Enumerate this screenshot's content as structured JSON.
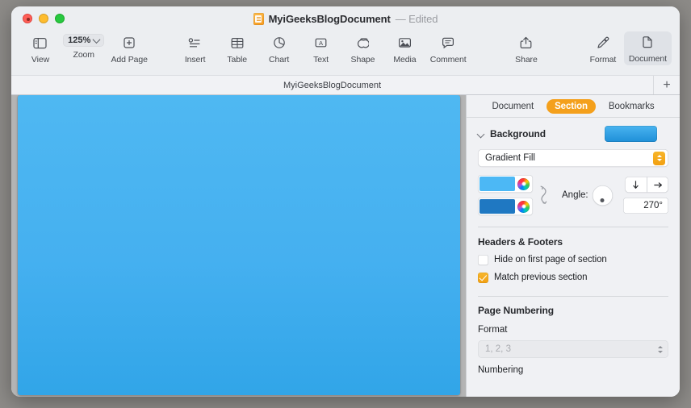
{
  "window": {
    "title": "MyiGeeksBlogDocument",
    "status": "— Edited",
    "doc_icon": "pages-document-icon"
  },
  "traffic_lights": {
    "close": "close-button",
    "minimize": "minimize-button",
    "zoom": "maximize-button"
  },
  "toolbar": {
    "view_label": "View",
    "zoom_value": "125%",
    "zoom_label": "Zoom",
    "add_page_label": "Add Page",
    "insert_label": "Insert",
    "table_label": "Table",
    "chart_label": "Chart",
    "text_label": "Text",
    "shape_label": "Shape",
    "media_label": "Media",
    "comment_label": "Comment",
    "share_label": "Share",
    "format_label": "Format",
    "document_label": "Document"
  },
  "tabbar": {
    "tab_title": "MyiGeeksBlogDocument",
    "add_tab": "+"
  },
  "inspector": {
    "segments": [
      {
        "label": "Document",
        "active": false
      },
      {
        "label": "Section",
        "active": true
      },
      {
        "label": "Bookmarks",
        "active": false
      }
    ],
    "background": {
      "title": "Background",
      "fill_type": "Gradient Fill",
      "swatch_color": "#3aa7e8",
      "start_color": "#4cb8f5",
      "end_color": "#1f78c2",
      "angle_label": "Angle:",
      "angle_value": "270°"
    },
    "headers_footers": {
      "title": "Headers & Footers",
      "hide_first_page": {
        "label": "Hide on first page of section",
        "checked": false
      },
      "match_previous": {
        "label": "Match previous section",
        "checked": true
      }
    },
    "page_numbering": {
      "title": "Page Numbering",
      "format_label": "Format",
      "format_value": "1, 2, 3",
      "numbering_label": "Numbering"
    }
  },
  "colors": {
    "accent_orange": "#f4a01c",
    "page_blue": "#45b0f0",
    "desktop": "#8d8b88"
  }
}
